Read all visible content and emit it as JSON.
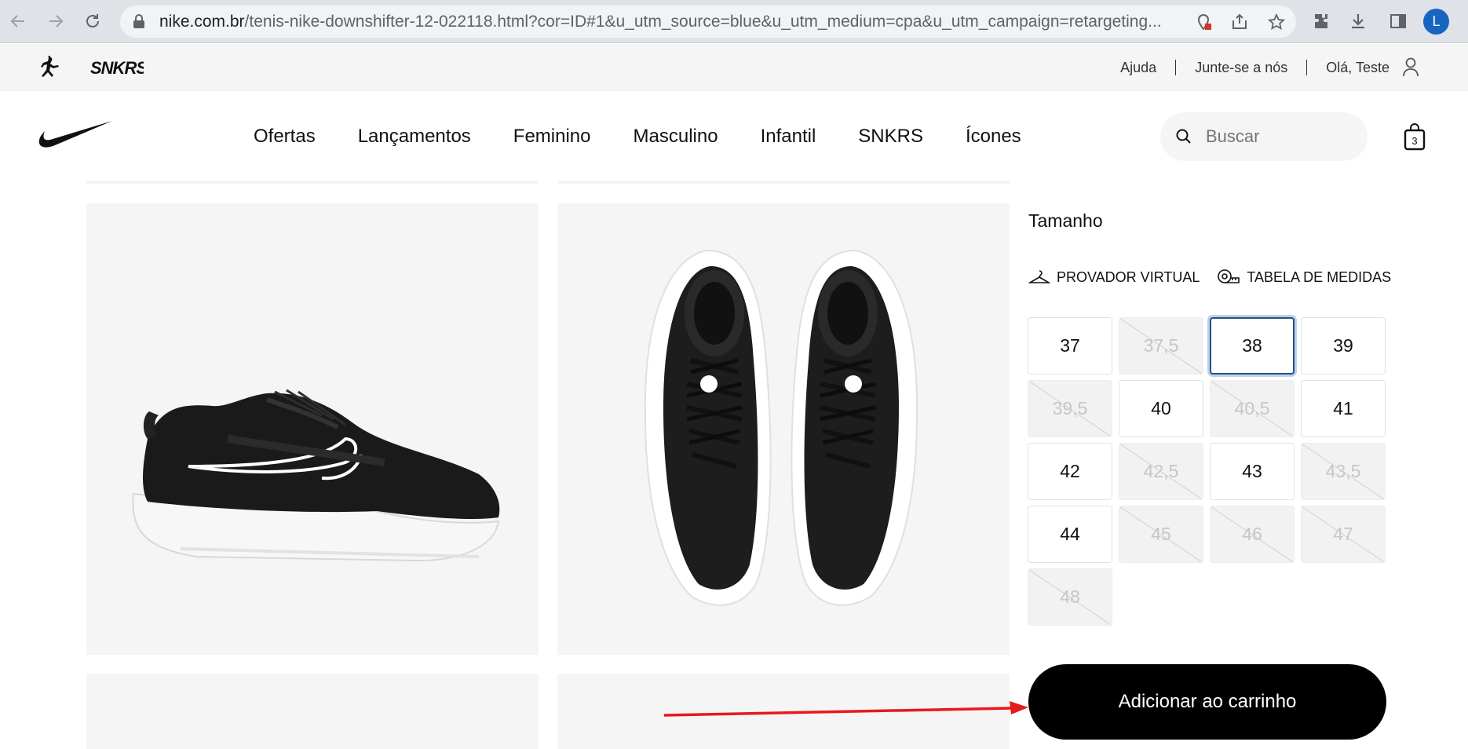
{
  "browser": {
    "url_host": "nike.com.br",
    "url_path": "/tenis-nike-downshifter-12-022118.html?cor=ID#1&u_utm_source=blue&u_utm_medium=cpa&u_utm_campaign=retargeting...",
    "avatar_letter": "L"
  },
  "utility": {
    "help": "Ajuda",
    "join": "Junte-se a nós",
    "greeting": "Olá, Teste"
  },
  "nav": {
    "items": [
      "Ofertas",
      "Lançamentos",
      "Feminino",
      "Masculino",
      "Infantil",
      "SNKRS",
      "Ícones"
    ],
    "search_placeholder": "Buscar",
    "bag_count": "3"
  },
  "product": {
    "size_title": "Tamanho",
    "virtual_fitting": "PROVADOR VIRTUAL",
    "size_chart": "TABELA DE MEDIDAS",
    "sizes": [
      {
        "label": "37",
        "available": true
      },
      {
        "label": "37,5",
        "available": false
      },
      {
        "label": "38",
        "available": true,
        "selected": true
      },
      {
        "label": "39",
        "available": true
      },
      {
        "label": "39,5",
        "available": false
      },
      {
        "label": "40",
        "available": true
      },
      {
        "label": "40,5",
        "available": false
      },
      {
        "label": "41",
        "available": true
      },
      {
        "label": "42",
        "available": true
      },
      {
        "label": "42,5",
        "available": false
      },
      {
        "label": "43",
        "available": true
      },
      {
        "label": "43,5",
        "available": false
      },
      {
        "label": "44",
        "available": true
      },
      {
        "label": "45",
        "available": false
      },
      {
        "label": "46",
        "available": false
      },
      {
        "label": "47",
        "available": false
      },
      {
        "label": "48",
        "available": false
      }
    ],
    "add_to_cart": "Adicionar ao carrinho"
  },
  "colors": {
    "annotation_arrow": "#e8191b",
    "avatar": "#1765c0",
    "selected_border": "#2a4f7f"
  }
}
